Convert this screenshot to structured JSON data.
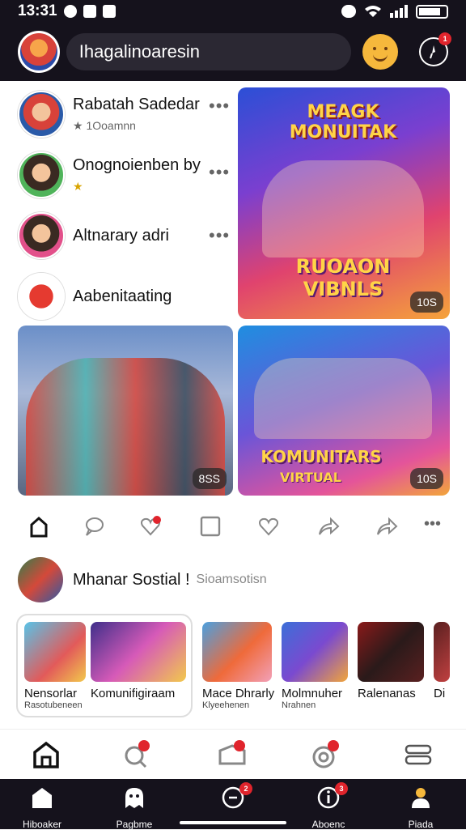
{
  "status": {
    "time": "13:31"
  },
  "search": {
    "text": "Ihagalinoaresin"
  },
  "friends": [
    {
      "name": "Rabatah Sadedar",
      "sub": "★ 1Ooamnn"
    },
    {
      "name": "Onognoienben by",
      "sub": "★"
    },
    {
      "name": "Altnarary adri",
      "sub": ""
    },
    {
      "name": "Aabenitaating",
      "sub": ""
    }
  ],
  "cards": {
    "top_right": {
      "line1": "MEAGK MONUITAK",
      "line2": "RUOAON VIBNLS",
      "duration": "10S"
    },
    "bottom_left": {
      "duration": "8SS"
    },
    "bottom_right": {
      "line1": "KOMUNITARS",
      "line2": "VIRTUAL",
      "duration": "10S"
    }
  },
  "post": {
    "name": "Mhanar Sostial !",
    "subtitle": "Sioamsotisn"
  },
  "strip": [
    {
      "title": "Nensorlar",
      "sub": "Rasotubeneen"
    },
    {
      "title": "Komunifigiraam",
      "sub": ""
    },
    {
      "title": "Mace Dhrarly",
      "sub": "Klyeehenen"
    },
    {
      "title": "Molmnuher",
      "sub": "Nrahnen"
    },
    {
      "title": "Ralenanas",
      "sub": ""
    },
    {
      "title": "Di",
      "sub": ""
    }
  ],
  "bottom_nav": [
    "Hiboaker",
    "Pagbme",
    "",
    "Aboenc",
    "Piada"
  ],
  "badges": {
    "bn1": "2",
    "bn2": "3",
    "bn3": "1"
  },
  "colors": {
    "bar": "#15121c",
    "badge": "#e0242c",
    "accent": "#f6b83c"
  }
}
